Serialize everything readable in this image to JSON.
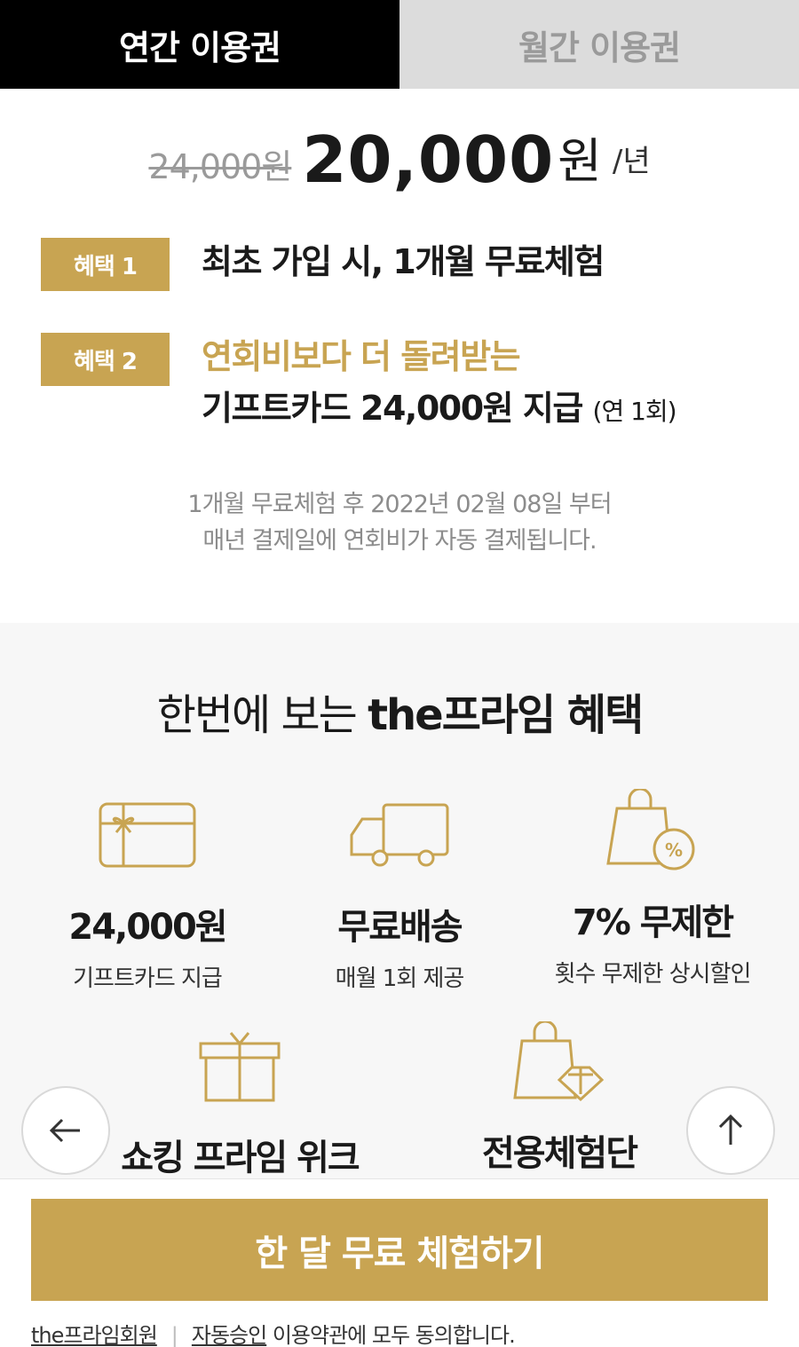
{
  "tabs": [
    {
      "label": "연간 이용권",
      "active": true
    },
    {
      "label": "월간 이용권",
      "active": false
    }
  ],
  "price": {
    "original": "24,000원",
    "current": "20,000",
    "unit": "원",
    "period": "/년"
  },
  "benefits": [
    {
      "badge": "혜택 1",
      "text": "최초 가입 시, 1개월 무료체험"
    },
    {
      "badge": "혜택 2",
      "text_gold": "연회비보다 더 돌려받는",
      "text": "기프트카드 24,000원 지급",
      "note": "(연 1회)"
    }
  ],
  "notice": {
    "line1": "1개월 무료체험 후 2022년 02월 08일 부터",
    "line2": "매년 결제일에 연회비가 자동 결제됩니다."
  },
  "summary": {
    "title_prefix": "한번에 보는 ",
    "title_bold": "the프라임 혜택",
    "features": [
      {
        "icon": "gift-card-icon",
        "title": "24,000원",
        "subtitle": "기프트카드 지급"
      },
      {
        "icon": "delivery-truck-icon",
        "title": "무료배송",
        "subtitle": "매월 1회 제공"
      },
      {
        "icon": "discount-bag-icon",
        "title": "7% 무제한",
        "subtitle": "횟수 무제한 상시할인"
      },
      {
        "icon": "gift-box-icon",
        "title": "쇼킹 프라임 위크",
        "subtitle": ""
      },
      {
        "icon": "diamond-bag-icon",
        "title": "전용체험단",
        "subtitle": ""
      }
    ]
  },
  "cta": {
    "label": "한 달 무료 체험하기"
  },
  "terms": {
    "link1": "the프라임회원",
    "separator": "|",
    "link2": "자동승인",
    "text": " 이용약관에 모두 동의합니다."
  },
  "colors": {
    "accent": "#c8a452",
    "tab_active_bg": "#000000",
    "tab_inactive_bg": "#dcdcdc"
  }
}
